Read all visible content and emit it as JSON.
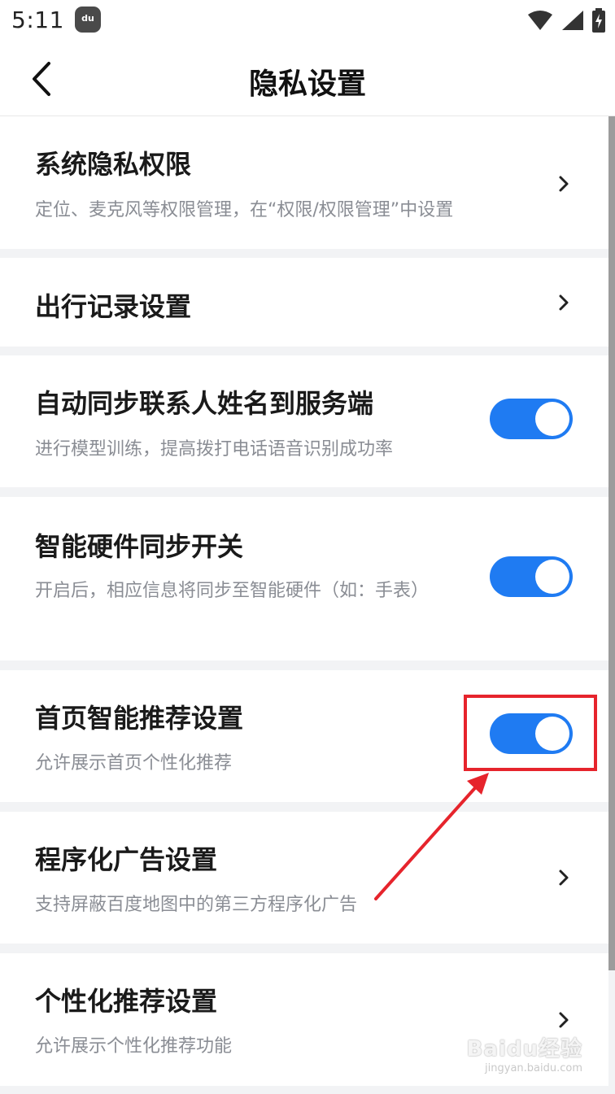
{
  "status_bar": {
    "time": "5:11",
    "app_icon_label": "du"
  },
  "header": {
    "title": "隐私设置"
  },
  "settings": [
    {
      "title": "系统隐私权限",
      "description": "定位、麦克风等权限管理，在“权限/权限管理”中设置",
      "control": "chevron"
    },
    {
      "title": "出行记录设置",
      "description": "",
      "control": "chevron"
    },
    {
      "title": "自动同步联系人姓名到服务端",
      "description": "进行模型训练，提高拨打电话语音识别成功率",
      "control": "toggle",
      "on": true
    },
    {
      "title": "智能硬件同步开关",
      "description": "开启后，相应信息将同步至智能硬件（如：手表）",
      "control": "toggle",
      "on": true
    },
    {
      "title": "首页智能推荐设置",
      "description": "允许展示首页个性化推荐",
      "control": "toggle",
      "on": true
    },
    {
      "title": "程序化广告设置",
      "description": "支持屏蔽百度地图中的第三方程序化广告",
      "control": "chevron"
    },
    {
      "title": "个性化推荐设置",
      "description": "允许展示个性化推荐功能",
      "control": "chevron"
    }
  ],
  "colors": {
    "toggle_on": "#1f7bf2",
    "annotation": "#e6242c",
    "background": "#f2f3f5"
  },
  "watermark": {
    "main": "Baidu经验",
    "sub": "jingyan.baidu.com"
  }
}
